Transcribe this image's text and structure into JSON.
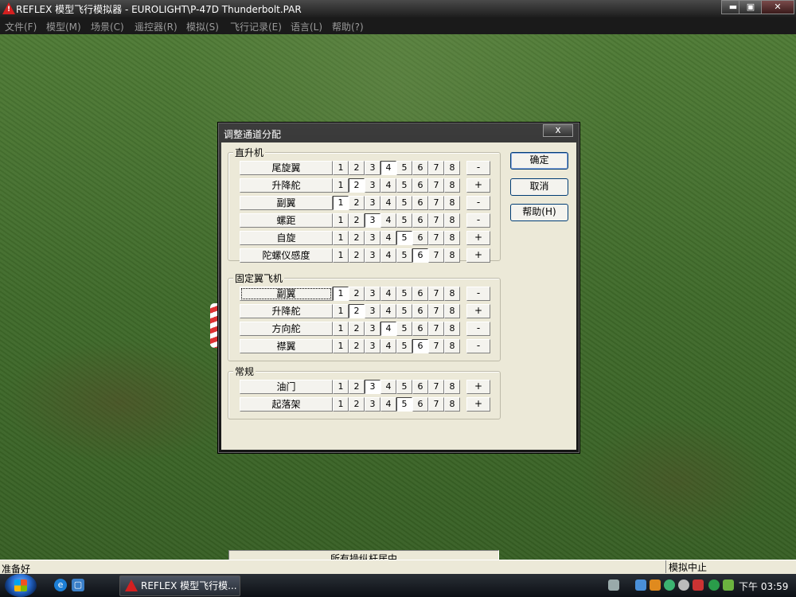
{
  "window": {
    "title": "REFLEX 模型飞行模拟器 - EUROLIGHT\\P-47D Thunderbolt.PAR",
    "icon_glyph": "!",
    "controls": {
      "minimize": "▬",
      "maximize": "▣",
      "close": "✕"
    }
  },
  "menu": [
    "文件(F)",
    "模型(M)",
    "场景(C)",
    "遥控器(R)",
    "模拟(S)",
    "飞行记录(E)",
    "语言(L)",
    "帮助(?)"
  ],
  "dialog": {
    "title": "调整通道分配",
    "close_label": "x",
    "channel_numbers": [
      "1",
      "2",
      "3",
      "4",
      "5",
      "6",
      "7",
      "8"
    ],
    "groups": [
      {
        "label": "直升机",
        "rows": [
          {
            "name": "尾旋翼",
            "selected": 4,
            "sign": "-"
          },
          {
            "name": "升降舵",
            "selected": 2,
            "sign": "+"
          },
          {
            "name": "副翼",
            "selected": 1,
            "sign": "-"
          },
          {
            "name": "螺距",
            "selected": 3,
            "sign": "-"
          },
          {
            "name": "自旋",
            "selected": 5,
            "sign": "+"
          },
          {
            "name": "陀螺仪感度",
            "selected": 6,
            "sign": "+"
          }
        ]
      },
      {
        "label": "固定翼飞机",
        "rows": [
          {
            "name": "副翼",
            "selected": 1,
            "sign": "-",
            "focused": true
          },
          {
            "name": "升降舵",
            "selected": 2,
            "sign": "+"
          },
          {
            "name": "方向舵",
            "selected": 4,
            "sign": "-"
          },
          {
            "name": "襟翼",
            "selected": 6,
            "sign": "-"
          }
        ]
      },
      {
        "label": "常规",
        "rows": [
          {
            "name": "油门",
            "selected": 3,
            "sign": "+"
          },
          {
            "name": "起落架",
            "selected": 5,
            "sign": "+"
          }
        ]
      }
    ],
    "buttons": {
      "ok": "确定",
      "cancel": "取消",
      "help": "帮助(H)"
    },
    "status": "所有操纵杆居中"
  },
  "statusbar": {
    "left": "准备好",
    "right": "模拟中止"
  },
  "taskbar": {
    "task_label": "REFLEX 模型飞行模...",
    "clock": "下午 03:59",
    "quicklaunch": [
      "ie-icon",
      "show-desktop-icon"
    ]
  },
  "colors": {
    "grass": "#3f6a2a",
    "dialog_face": "#ece9d8",
    "titlebar": "#1c1c1c"
  }
}
